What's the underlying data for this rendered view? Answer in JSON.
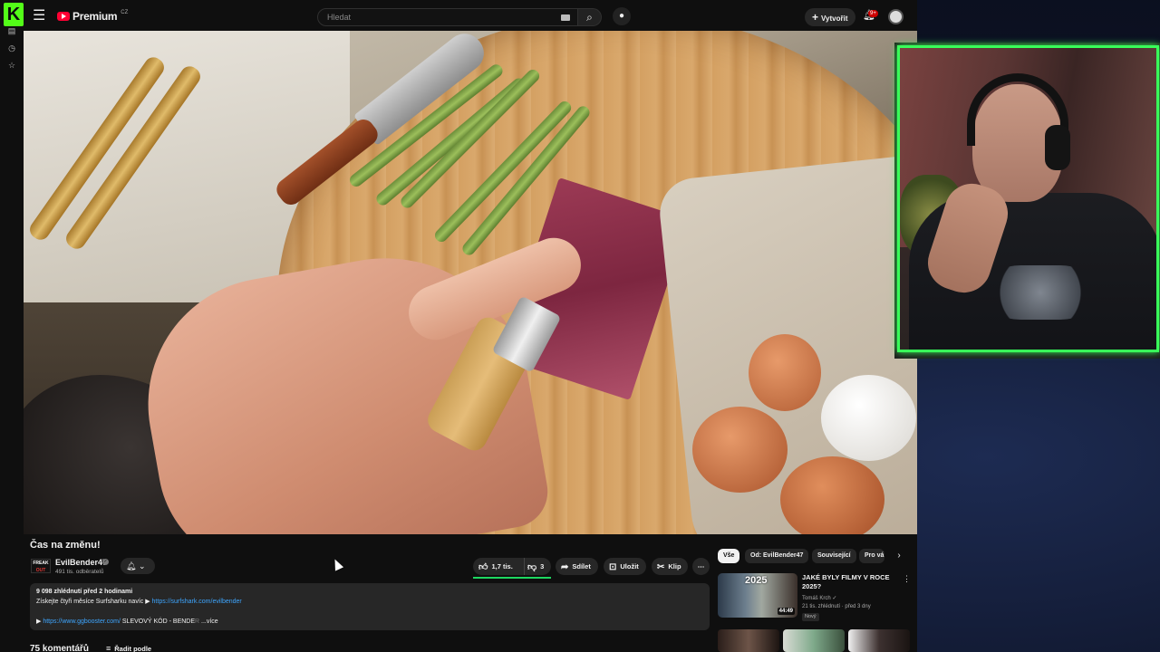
{
  "header": {
    "kick_badge": "K",
    "logo_text": "Premium",
    "logo_country": "CZ",
    "search_placeholder": "Hledat",
    "create_label": "Vytvořit",
    "notification_count": "9+"
  },
  "video": {
    "title": "Čas na změnu!",
    "channel": {
      "logo_top": "FREAK",
      "logo_bottom": "OUT",
      "name": "EvilBender47",
      "subscribers": "491 tis. odběratelů"
    },
    "actions": {
      "likes": "1,7 tis.",
      "dislikes": "3",
      "share": "Sdílet",
      "save": "Uložit",
      "clip": "Klip"
    },
    "description": {
      "views_and_age": "9 098 zhlédnutí  před 2 hodinami",
      "line2_text": "Získejte čtyři měsíce Surfsharku navíc ▶ ",
      "line2_link": "https://surfshark.com/evilbender",
      "line3_prefix": "▶ ",
      "line3_link": "https://www.ggbooster.com/",
      "line3_text": " SLEVOVÝ KÓD - BENDE",
      "line3_fade": "R ",
      "more": "...více"
    },
    "comments_count": "75 komentářů",
    "sort_label": "Řadit podle"
  },
  "recommendations": {
    "chips": [
      "Vše",
      "Od: EvilBender47",
      "Související",
      "Pro vá"
    ],
    "items": [
      {
        "thumb_text": "2025",
        "duration": "44:49",
        "title": "JAKÉ BYLY FILMY V ROCE 2025?",
        "channel": "Tomáš Krch",
        "meta": "21 tis. zhlédnutí · před 3 dny",
        "badge": "Nový"
      }
    ]
  },
  "colors": {
    "kick_green": "#53fc18",
    "yt_red": "#ff0033",
    "cam_border": "#39ff5a",
    "link_blue": "#3ea6ff"
  }
}
